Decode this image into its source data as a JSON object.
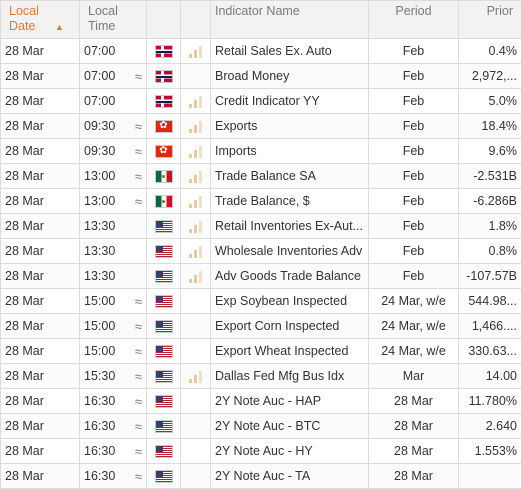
{
  "header": {
    "date_label": "Local Date",
    "time_label": "Local Time",
    "indicator_label": "Indicator Name",
    "period_label": "Period",
    "prior_label": "Prior",
    "sort_glyph": "▲"
  },
  "colors": {
    "accent": "#e8772e",
    "border": "#dcdcdc",
    "header_bg": "#f2f2f2"
  },
  "rows": [
    {
      "date": "28 Mar",
      "time": "07:00",
      "approx": "",
      "flag": "norway-flag-icon",
      "bars": true,
      "name": "Retail Sales Ex. Auto",
      "period": "Feb",
      "prior": "0.4%"
    },
    {
      "date": "28 Mar",
      "time": "07:00",
      "approx": "≈",
      "flag": "norway-flag-icon",
      "bars": false,
      "name": "Broad Money",
      "period": "Feb",
      "prior": "2,972,..."
    },
    {
      "date": "28 Mar",
      "time": "07:00",
      "approx": "",
      "flag": "norway-flag-icon",
      "bars": true,
      "name": "Credit Indicator YY",
      "period": "Feb",
      "prior": "5.0%"
    },
    {
      "date": "28 Mar",
      "time": "09:30",
      "approx": "≈",
      "flag": "hong-kong-flag-icon",
      "bars": true,
      "name": "Exports",
      "period": "Feb",
      "prior": "18.4%"
    },
    {
      "date": "28 Mar",
      "time": "09:30",
      "approx": "≈",
      "flag": "hong-kong-flag-icon",
      "bars": true,
      "name": "Imports",
      "period": "Feb",
      "prior": "9.6%"
    },
    {
      "date": "28 Mar",
      "time": "13:00",
      "approx": "≈",
      "flag": "mexico-flag-icon",
      "bars": true,
      "name": "Trade Balance SA",
      "period": "Feb",
      "prior": "-2.531B"
    },
    {
      "date": "28 Mar",
      "time": "13:00",
      "approx": "≈",
      "flag": "mexico-flag-icon",
      "bars": true,
      "name": "Trade Balance, $",
      "period": "Feb",
      "prior": "-6.286B"
    },
    {
      "date": "28 Mar",
      "time": "13:30",
      "approx": "",
      "flag": "us-flag-icon",
      "bars": true,
      "name": "Retail Inventories Ex-Aut...",
      "period": "Feb",
      "prior": "1.8%"
    },
    {
      "date": "28 Mar",
      "time": "13:30",
      "approx": "",
      "flag": "us-flag-icon",
      "bars": true,
      "name": "Wholesale Inventories Adv",
      "period": "Feb",
      "prior": "0.8%"
    },
    {
      "date": "28 Mar",
      "time": "13:30",
      "approx": "",
      "flag": "us-flag-icon",
      "bars": true,
      "name": "Adv Goods Trade Balance",
      "period": "Feb",
      "prior": "-107.57B"
    },
    {
      "date": "28 Mar",
      "time": "15:00",
      "approx": "≈",
      "flag": "us-flag-icon",
      "bars": false,
      "name": "Exp Soybean Inspected",
      "period": "24 Mar, w/e",
      "prior": "544.98..."
    },
    {
      "date": "28 Mar",
      "time": "15:00",
      "approx": "≈",
      "flag": "us-flag-icon",
      "bars": false,
      "name": "Export Corn Inspected",
      "period": "24 Mar, w/e",
      "prior": "1,466...."
    },
    {
      "date": "28 Mar",
      "time": "15:00",
      "approx": "≈",
      "flag": "us-flag-icon",
      "bars": false,
      "name": "Export Wheat Inspected",
      "period": "24 Mar, w/e",
      "prior": "330.63..."
    },
    {
      "date": "28 Mar",
      "time": "15:30",
      "approx": "≈",
      "flag": "us-flag-icon",
      "bars": true,
      "name": "Dallas Fed Mfg Bus Idx",
      "period": "Mar",
      "prior": "14.00"
    },
    {
      "date": "28 Mar",
      "time": "16:30",
      "approx": "≈",
      "flag": "us-flag-icon",
      "bars": false,
      "name": "2Y Note Auc - HAP",
      "period": "28 Mar",
      "prior": "11.780%"
    },
    {
      "date": "28 Mar",
      "time": "16:30",
      "approx": "≈",
      "flag": "us-flag-icon",
      "bars": false,
      "name": "2Y Note Auc - BTC",
      "period": "28 Mar",
      "prior": "2.640"
    },
    {
      "date": "28 Mar",
      "time": "16:30",
      "approx": "≈",
      "flag": "us-flag-icon",
      "bars": false,
      "name": "2Y Note Auc - HY",
      "period": "28 Mar",
      "prior": "1.553%"
    },
    {
      "date": "28 Mar",
      "time": "16:30",
      "approx": "≈",
      "flag": "us-flag-icon",
      "bars": false,
      "name": "2Y Note Auc - TA",
      "period": "28 Mar",
      "prior": ""
    }
  ]
}
